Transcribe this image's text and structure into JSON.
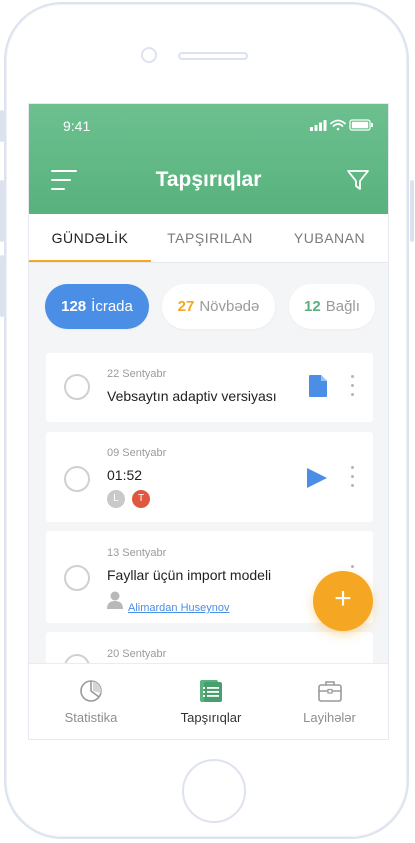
{
  "status_bar": {
    "time": "9:41"
  },
  "app_bar": {
    "title": "Tapşırıqlar",
    "menu_icon": "menu-icon",
    "filter_icon": "filter-icon"
  },
  "tabs": [
    {
      "label": "GÜNDƏLİK",
      "active": true
    },
    {
      "label": "TAPŞIRILAN",
      "active": false
    },
    {
      "label": "YUBANAN",
      "active": false
    }
  ],
  "filters": [
    {
      "count": "128",
      "label": "İcrada",
      "active": true,
      "count_color": "#ffffff"
    },
    {
      "count": "27",
      "label": "Növbədə",
      "active": false,
      "count_color": "#f5a623"
    },
    {
      "count": "12",
      "label": "Bağlı",
      "active": false,
      "count_color": "#58b27d"
    }
  ],
  "tasks": [
    {
      "date": "22 Sentyabr",
      "title": "Vebsaytın adaptiv versiyası",
      "action_icon": "document-icon"
    },
    {
      "date": "09 Sentyabr",
      "title": "01:52",
      "action_icon": "play-icon",
      "avatars": [
        {
          "letter": "L",
          "color": "#c9c9c9"
        },
        {
          "letter": "T",
          "color": "#e0573f"
        }
      ]
    },
    {
      "date": "13 Sentyabr",
      "title": "Fayllar üçün import modeli",
      "assignee": "Alimardan Huseynov"
    },
    {
      "date": "20 Sentyabr"
    }
  ],
  "fab": {
    "label": "+"
  },
  "bottom_nav": [
    {
      "label": "Statistika",
      "icon": "pie-chart-icon",
      "active": false
    },
    {
      "label": "Tapşırıqlar",
      "icon": "task-list-icon",
      "active": true
    },
    {
      "label": "Layihələr",
      "icon": "briefcase-icon",
      "active": false
    }
  ],
  "colors": {
    "primary_green": "#58b27d",
    "accent_orange": "#f5a623",
    "active_blue": "#4a8ee6"
  }
}
